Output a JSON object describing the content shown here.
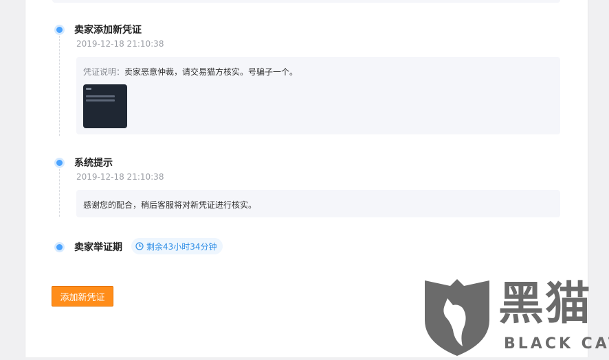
{
  "timeline": {
    "events": [
      {
        "title": "卖家添加新凭证",
        "time": "2019-12-18 21:10:38",
        "desc_label": "凭证说明：",
        "desc_text": "卖家恶意仲裁，请交易猫方核实。号骗子一个。"
      },
      {
        "title": "系统提示",
        "time": "2019-12-18 21:10:38",
        "message": "感谢您的配合，稍后客服将对新凭证进行核实。"
      },
      {
        "title": "卖家举证期",
        "remaining": "剩余43小时34分钟"
      }
    ]
  },
  "actions": {
    "add_evidence_label": "添加新凭证"
  },
  "watermark": {
    "logo_text": "黑猫",
    "sub_text": "BLACK CAT"
  },
  "colors": {
    "accent_blue": "#4aa3ff",
    "button_orange": "#ff8d1a",
    "card_bg": "#f5f6fa"
  }
}
